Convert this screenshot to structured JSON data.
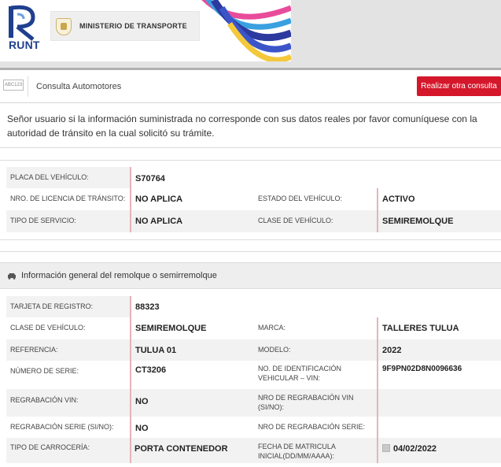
{
  "header": {
    "logo_text": "RUNT",
    "ministry": "MINISTERIO DE TRANSPORTE"
  },
  "consulta": {
    "badge": "ABC123",
    "title": "Consulta Automotores",
    "button_label": "Realizar otra consulta"
  },
  "notice": "Señor usuario si la información suministrada no corresponde con sus datos reales por favor comuníquese con la autoridad de tránsito en la cual solicitó su trámite.",
  "vehicle": {
    "placa_label": "PLACA DEL VEHÍCULO:",
    "placa": "S70764",
    "licencia_label": "NRO. DE LICENCIA DE TRÁNSITO:",
    "licencia": "NO APLICA",
    "estado_label": "ESTADO DEL VEHÍCULO:",
    "estado": "ACTIVO",
    "servicio_label": "TIPO DE SERVICIO:",
    "servicio": "NO APLICA",
    "clase_label": "CLASE DE VEHÍCULO:",
    "clase": "SEMIREMOLQUE"
  },
  "remolque": {
    "section_title": "Información general del remolque o semirremolque",
    "tarjeta_label": "TARJETA DE REGISTRO:",
    "tarjeta": "88323",
    "clase_label": "CLASE DE VEHÍCULO:",
    "clase": "SEMIREMOLQUE",
    "marca_label": "MARCA:",
    "marca": "TALLERES TULUA",
    "referencia_label": "REFERENCIA:",
    "referencia": "TULUA 01",
    "modelo_label": "MODELO:",
    "modelo": "2022",
    "serie_label": "NÚMERO DE SERIE:",
    "serie": "CT3206",
    "vin_label": "NO. DE IDENTIFICACIÓN VEHICULAR – VIN:",
    "vin": "9F9PN02D8N0096636",
    "regrab_vin_label": "REGRABACIÓN VIN:",
    "regrab_vin": "NO",
    "nro_regrab_vin_label": "NRO DE REGRABACIÓN VIN (SI/NO):",
    "nro_regrab_vin": "",
    "regrab_serie_label": "REGRABACIÓN SERIE (SI/NO):",
    "regrab_serie": "NO",
    "nro_regrab_serie_label": "NRO DE REGRABACIÓN SERIE:",
    "nro_regrab_serie": "",
    "carroceria_label": "TIPO DE CARROCERÍA:",
    "carroceria": "PORTA CONTENEDOR",
    "fecha_label": "FECHA DE MATRICULA INICIAL(DD/MM/AAAA):",
    "fecha": "04/02/2022"
  },
  "colors": {
    "accent_red": "#d5172b",
    "runt_blue": "#1f3f8f"
  }
}
